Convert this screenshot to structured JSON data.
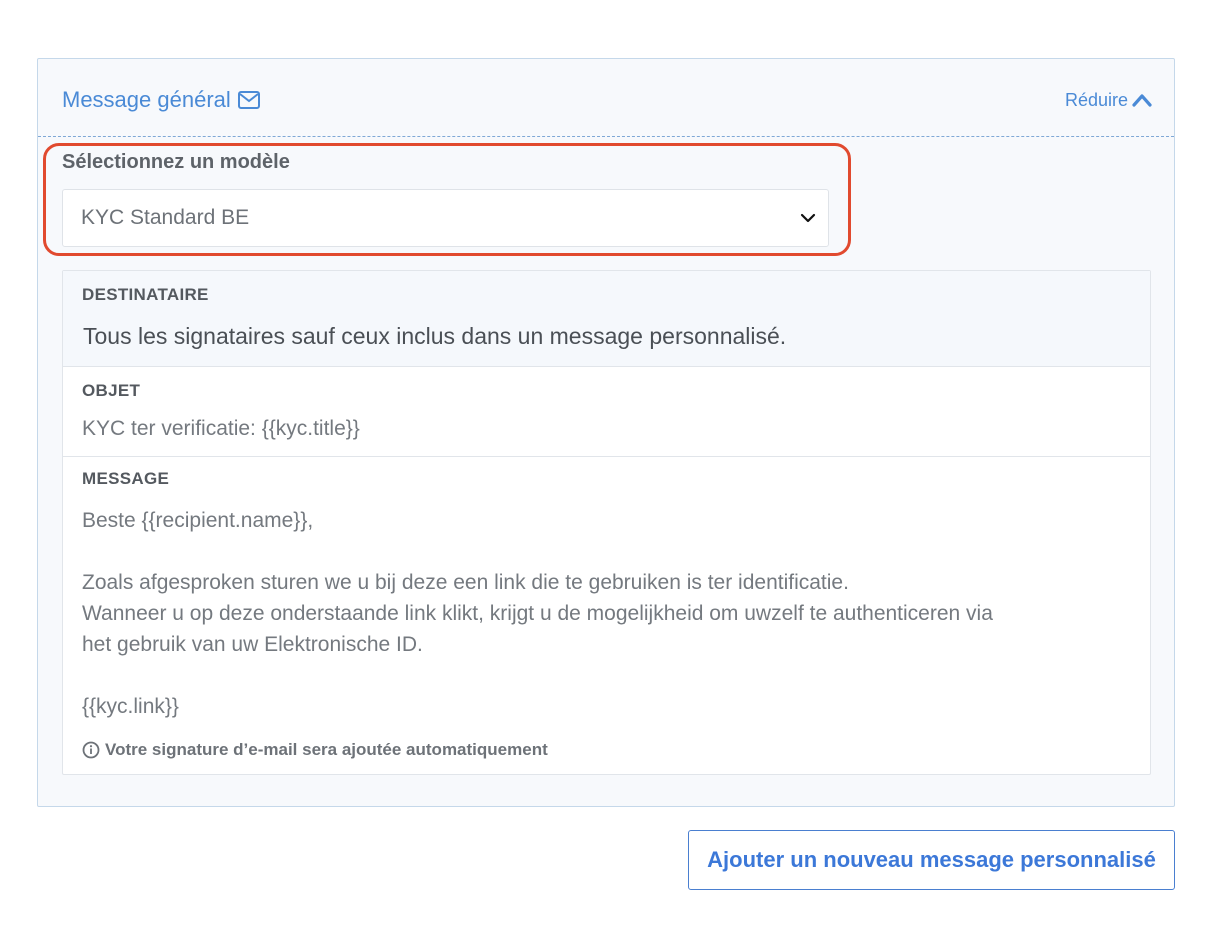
{
  "general_message": {
    "title": "Message général",
    "title_icon": "envelope-icon",
    "collapse_label": "Réduire",
    "collapse_icon": "chevron-up-icon"
  },
  "template_select": {
    "label": "Sélectionnez un modèle",
    "selected_value": "KYC Standard BE",
    "icon": "chevron-down-icon"
  },
  "recipient": {
    "label": "DESTINATAIRE",
    "value": "Tous les signataires sauf ceux inclus dans un message personnalisé."
  },
  "subject": {
    "label": "OBJET",
    "value": "KYC ter verificatie: {{kyc.title}}"
  },
  "message": {
    "label": "MESSAGE",
    "lines": [
      "Beste {{recipient.name}},",
      "",
      "Zoals afgesproken sturen we u bij deze een link die te gebruiken is ter identificatie.",
      "Wanneer u op deze onderstaande link klikt, krijgt u de mogelijkheid om uwzelf te authenticeren via",
      "het gebruik van uw Elektronische ID.",
      "",
      "{{kyc.link}}"
    ],
    "signature_note": "Votre signature d’e-mail sera ajoutée automatiquement",
    "signature_icon": "info-icon"
  },
  "add_button": {
    "label": "Ajouter un nouveau message personnalisé"
  },
  "colors": {
    "accent": "#4a8ad6",
    "highlight": "#e14a2f",
    "button_text": "#3c78d8"
  }
}
